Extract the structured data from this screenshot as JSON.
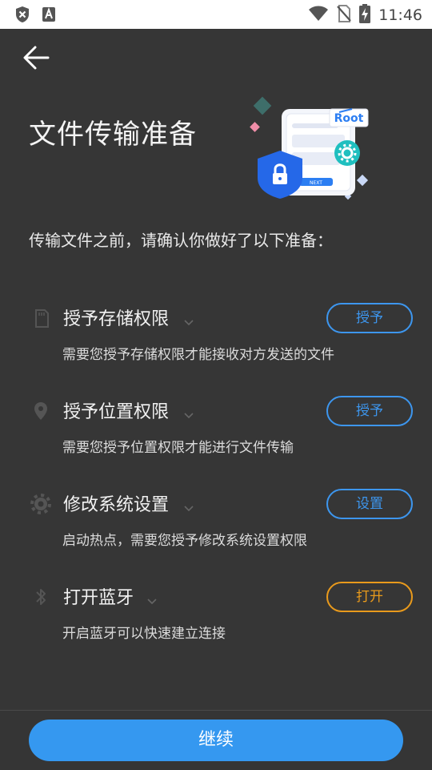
{
  "status_bar": {
    "time": "11:46",
    "left_icons": [
      "security-shield-icon",
      "text-a-icon"
    ],
    "right_icons": [
      "wifi-icon",
      "no-sim-icon",
      "battery-charging-icon"
    ]
  },
  "page": {
    "title": "文件传输准备",
    "intro": "传输文件之前，请确认你做好了以下准备：",
    "illustration": {
      "badge": "Root",
      "button": "NEXT"
    }
  },
  "items": [
    {
      "title": "授予存储权限",
      "desc": "需要您授予存储权限才能接收对方发送的文件",
      "button": "授予",
      "icon": "sd-card-icon",
      "button_color": "#3d96ee"
    },
    {
      "title": "授予位置权限",
      "desc": "需要您授予位置权限才能进行文件传输",
      "button": "授予",
      "icon": "location-pin-icon",
      "button_color": "#3d96ee"
    },
    {
      "title": "修改系统设置",
      "desc": "启动热点，需要您授予修改系统设置权限",
      "button": "设置",
      "icon": "gear-icon",
      "button_color": "#3d96ee"
    },
    {
      "title": "打开蓝牙",
      "desc": "开启蓝牙可以快速建立连接",
      "button": "打开",
      "icon": "bluetooth-icon",
      "button_color": "#e99a1c"
    }
  ],
  "footer": {
    "continue_label": "继续"
  },
  "colors": {
    "background": "#363636",
    "accent_blue": "#3598f0",
    "accent_orange": "#e99a1c"
  }
}
